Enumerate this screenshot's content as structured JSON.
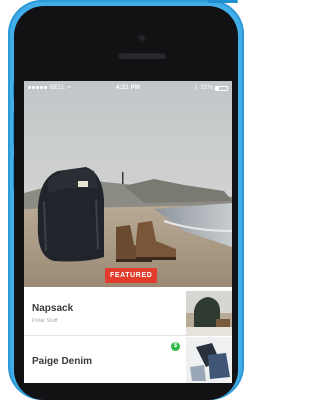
{
  "status_bar": {
    "carrier": "BELL",
    "time": "4:21 PM",
    "battery": "32%"
  },
  "hero": {
    "badge_label": "FEATURED"
  },
  "listings": [
    {
      "title": "Napsack",
      "subtitle": "Polar Stuff"
    },
    {
      "title": "Paige Denim",
      "badge": "$"
    }
  ],
  "colors": {
    "phone_body": "#41aeea",
    "featured_badge": "#e23c2c",
    "price_badge": "#2fb84a"
  }
}
